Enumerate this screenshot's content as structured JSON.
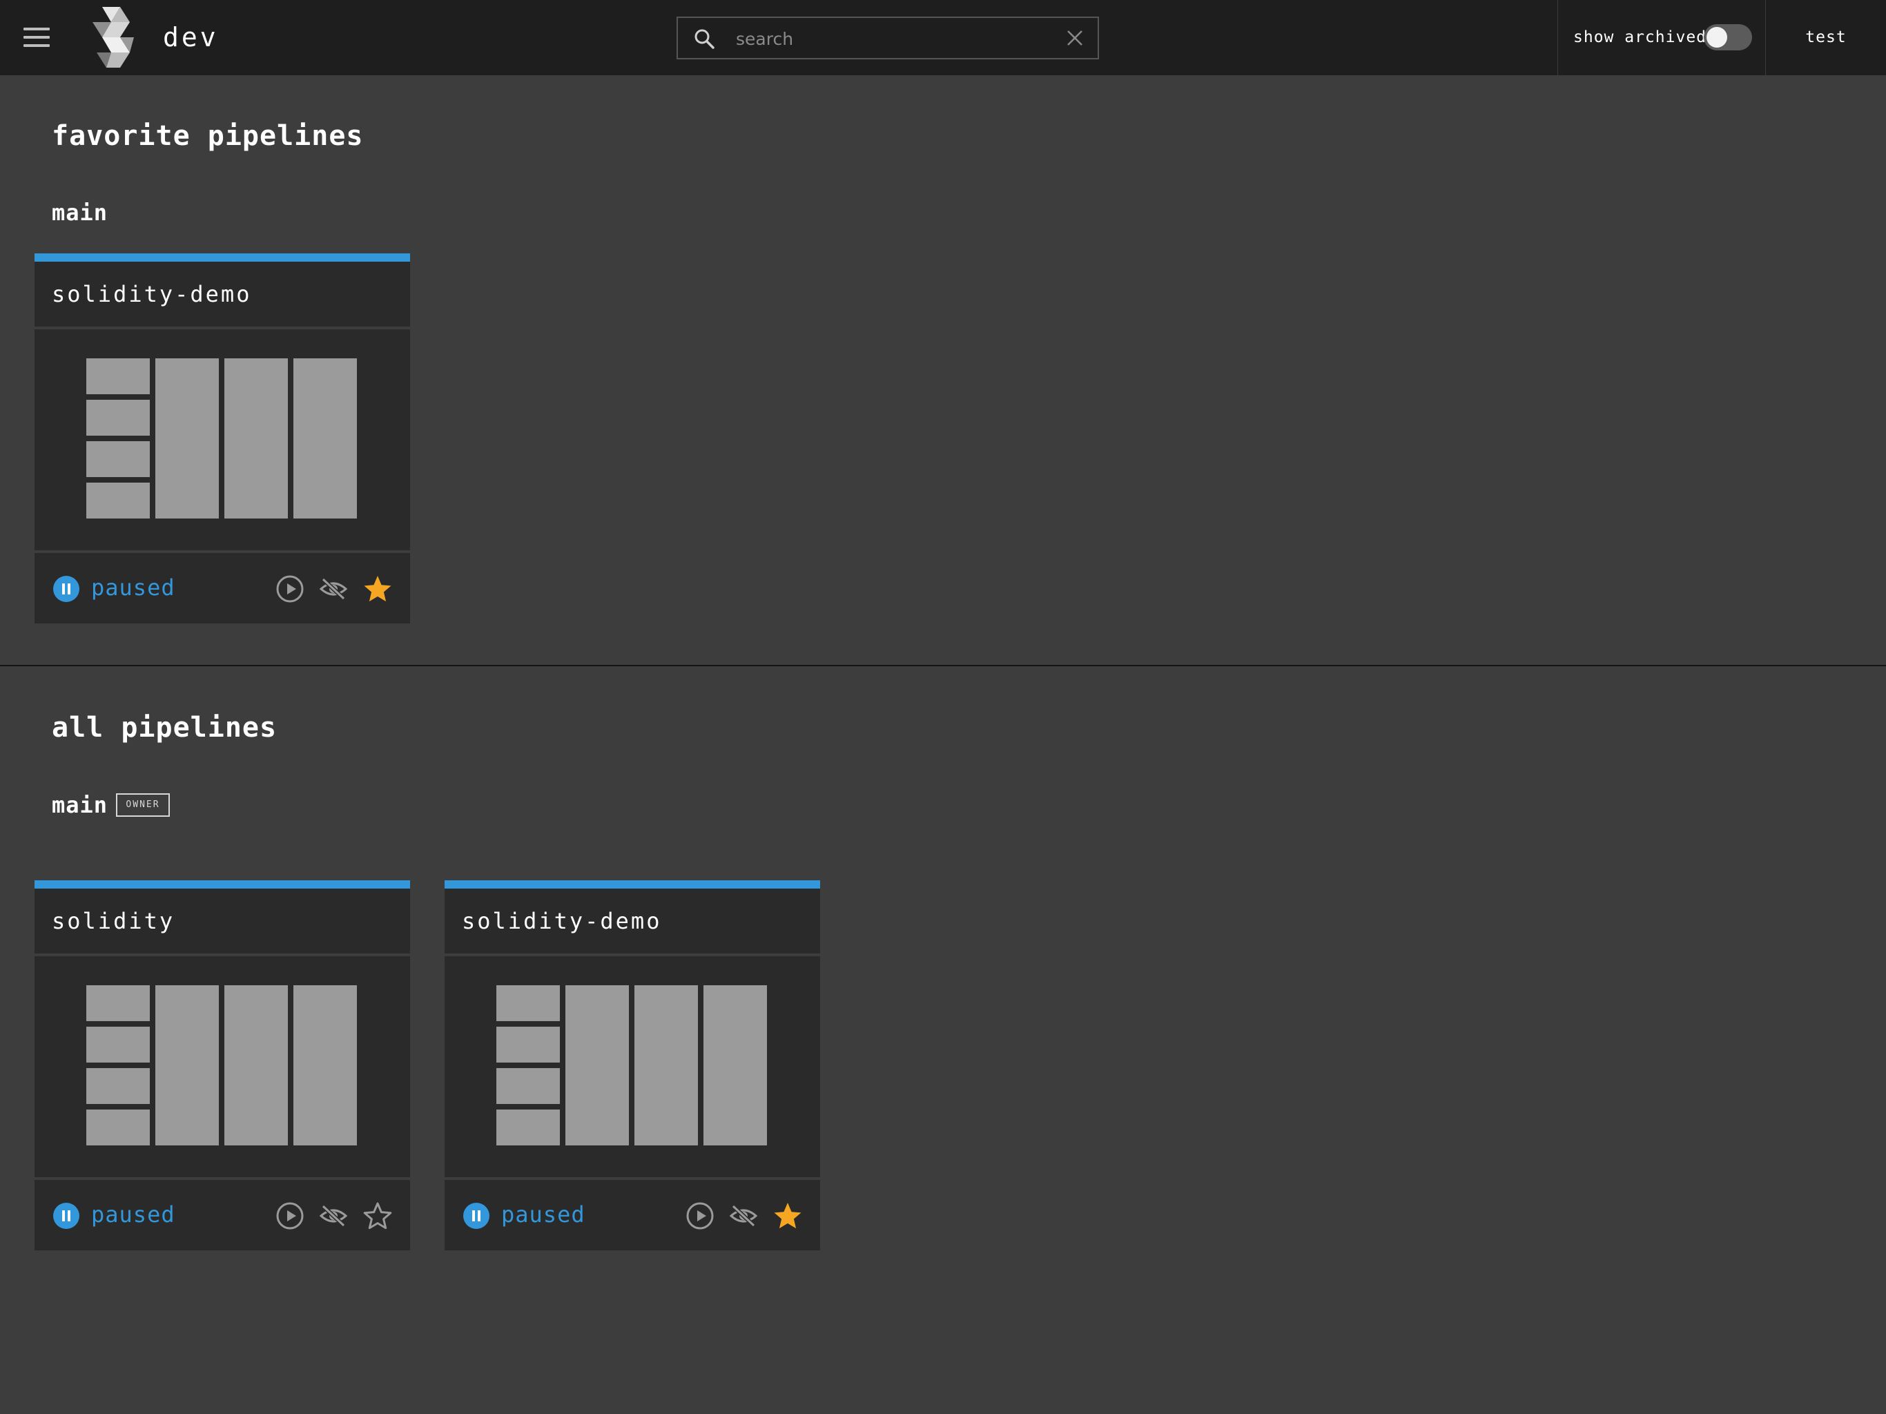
{
  "header": {
    "team": "dev",
    "search_placeholder": "search",
    "search_value": "",
    "show_archived_label": "show archived",
    "show_archived": false,
    "user": "test"
  },
  "favorites": {
    "title": "favorite pipelines",
    "team": "main",
    "pipelines": [
      {
        "name": "solidity-demo",
        "status": "paused",
        "favorited": true
      }
    ]
  },
  "all": {
    "title": "all pipelines",
    "team": "main",
    "badge": "OWNER",
    "pipelines": [
      {
        "name": "solidity",
        "status": "paused",
        "favorited": false
      },
      {
        "name": "solidity-demo",
        "status": "paused",
        "favorited": true
      }
    ]
  },
  "colors": {
    "accent": "#3397db",
    "favorite": "#f5a623",
    "paused": "#3397db"
  }
}
